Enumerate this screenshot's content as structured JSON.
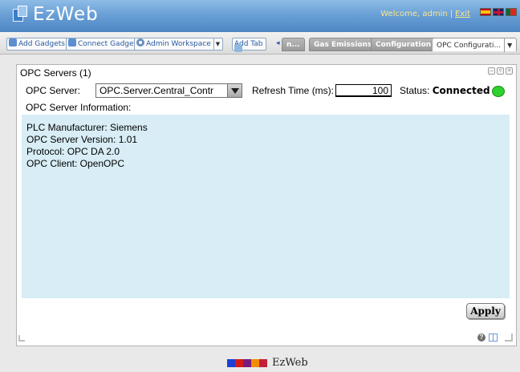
{
  "header": {
    "app_name": "EzWeb",
    "welcome_text": "Welcome, admin",
    "separator": "|",
    "exit_label": "Exit"
  },
  "toolbar": {
    "add_gadgets": "Add Gadgets",
    "connect_gadgets": "Connect Gadgets",
    "workspace_selector": "Admin Workspace",
    "add_tab": "Add Tab"
  },
  "tabs": [
    {
      "label": "n..."
    },
    {
      "label": "Gas Emissions"
    },
    {
      "label": "Configuration"
    },
    {
      "label": "OPC Configurati..."
    }
  ],
  "gadget": {
    "title": "OPC Servers (1)",
    "opc_server_label": "OPC Server:",
    "opc_server_value": "OPC.Server.Central_Contr",
    "refresh_label": "Refresh Time (ms):",
    "refresh_value": "100",
    "status_label": "Status:",
    "status_value": "Connected",
    "status_color": "#2fd12f",
    "info_heading": "OPC Server Information:",
    "info_lines": [
      "PLC Manufacturer: Siemens",
      "OPC Server Version: 1.01",
      "Protocol: OPC DA 2.0",
      "OPC Client: OpenOPC"
    ],
    "apply_label": "Apply"
  },
  "footer": {
    "name": "EzWeb",
    "block_colors": [
      "#1d3fd6",
      "#d61a1a",
      "#7a1a7a",
      "#f28c00",
      "#c21f3a"
    ]
  },
  "colors": {
    "header_blue": "#4d86c4",
    "info_bg": "#d8edf5",
    "welcome_text": "#ffe68a"
  }
}
